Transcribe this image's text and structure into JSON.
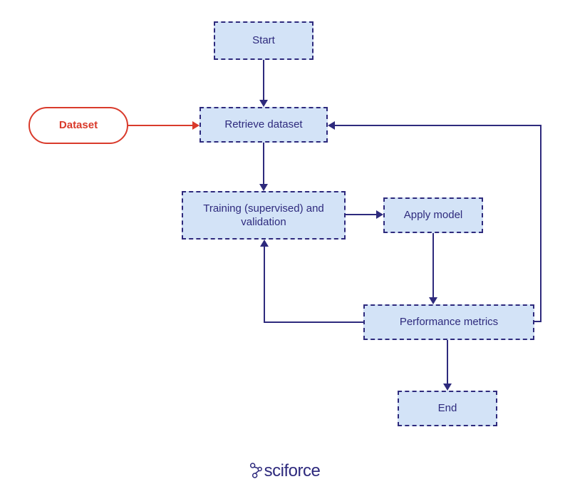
{
  "nodes": {
    "start": "Start",
    "dataset": "Dataset",
    "retrieve": "Retrieve dataset",
    "training": "Training (supervised) and validation",
    "apply": "Apply model",
    "metrics": "Performance metrics",
    "end": "End"
  },
  "logo": "sciforce"
}
